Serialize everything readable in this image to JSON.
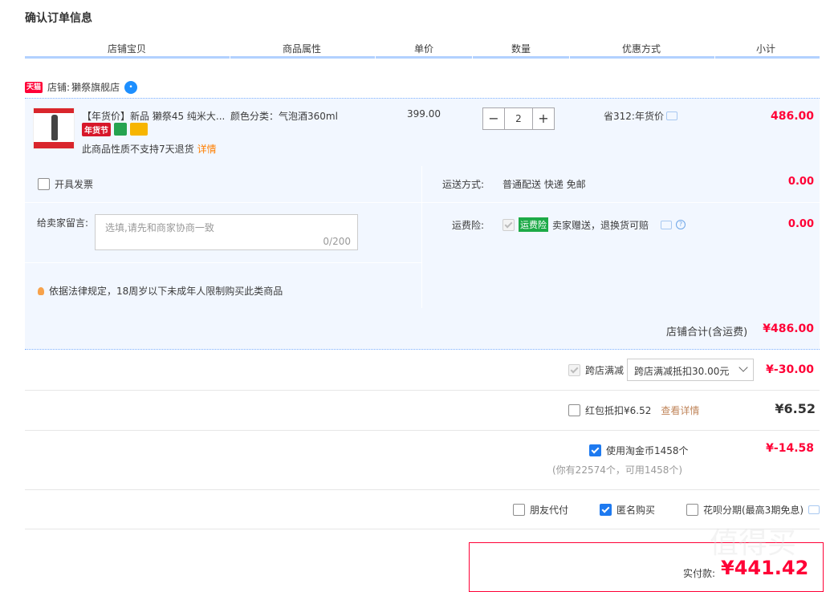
{
  "page": {
    "title": "确认订单信息"
  },
  "table_headers": [
    "店铺宝贝",
    "商品属性",
    "单价",
    "数量",
    "优惠方式",
    "小计"
  ],
  "shop": {
    "badge": "天猫",
    "label": "店铺:",
    "name": "獭祭旗舰店"
  },
  "item": {
    "name": "【年货价】新品 獭祭45 纯米大...",
    "badge_festival": "年货节",
    "notice": "此商品性质不支持7天退货",
    "notice_link": "详情",
    "attr": "颜色分类：气泡酒360ml",
    "unit_price": "399.00",
    "quantity": "2",
    "qty_minus": "−",
    "qty_plus": "+",
    "promo": "省312:年货价",
    "subtotal": "486.00"
  },
  "options": {
    "invoice_label": "开具发票",
    "memo_label": "给卖家留言:",
    "memo_placeholder": "选填,请先和商家协商一致",
    "memo_count": "0/200",
    "law_notice": "依据法律规定，18周岁以下未成年人限制购买此类商品",
    "shipping_label": "运送方式:",
    "shipping_value": "普通配送 快递 免邮",
    "shipping_fee": "0.00",
    "insurance_label": "运费险:",
    "insurance_badge": "运费险",
    "insurance_desc": "卖家赠送，退换货可赔",
    "insurance_fee": "0.00"
  },
  "shop_total": {
    "label": "店铺合计(含运费)",
    "value": "¥486.00"
  },
  "discounts": {
    "cross_store_label": "跨店满减",
    "cross_store_select": "跨店满减抵扣30.00元",
    "cross_store_value": "¥-30.00",
    "red_packet_label": "红包抵扣¥6.52",
    "red_packet_link": "查看详情",
    "red_packet_value": "¥6.52",
    "gold_label": "使用淘金币1458个",
    "gold_note": "(你有22574个，可用1458个)",
    "gold_value": "¥-14.58"
  },
  "pay_options": {
    "friend_pay": "朋友代付",
    "anonymous": "匿名购买",
    "huabei": "花呗分期(最高3期免息)"
  },
  "final": {
    "label": "实付款:",
    "value": "¥441.42"
  },
  "watermark": "值得买",
  "colors": {
    "accent_red": "#ff0036",
    "row_bg": "#f2f7ff",
    "header_line": "#b2d1ff",
    "check_blue": "#1e7af0"
  }
}
